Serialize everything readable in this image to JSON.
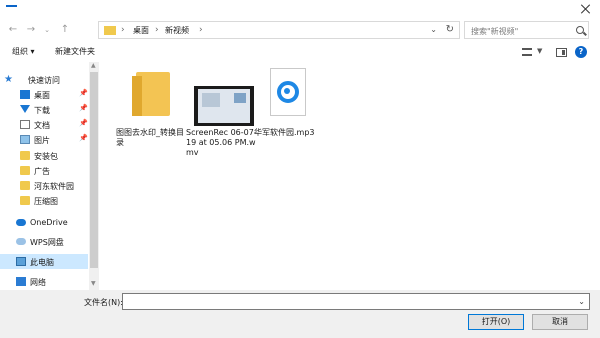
{
  "navbar": {
    "breadcrumbs": [
      "桌面",
      "新视频"
    ],
    "search_placeholder": "搜索\"新视频\""
  },
  "toolbar": {
    "organize": "组织 ▾",
    "new_folder": "新建文件夹"
  },
  "sidebar": {
    "items": [
      {
        "label": "快速访问",
        "icon": "star-icon"
      },
      {
        "label": "桌面",
        "icon": "desktop-icon",
        "pinned": true
      },
      {
        "label": "下载",
        "icon": "download-icon",
        "pinned": true
      },
      {
        "label": "文档",
        "icon": "document-icon",
        "pinned": true
      },
      {
        "label": "图片",
        "icon": "picture-icon",
        "pinned": true
      },
      {
        "label": "安装包",
        "icon": "folder-icon"
      },
      {
        "label": "广告",
        "icon": "folder-icon"
      },
      {
        "label": "河东软件园",
        "icon": "folder-icon"
      },
      {
        "label": "压缩图",
        "icon": "folder-icon"
      },
      {
        "label": "OneDrive",
        "icon": "cloud-icon"
      },
      {
        "label": "WPS网盘",
        "icon": "cloud-icon"
      },
      {
        "label": "此电脑",
        "icon": "computer-icon",
        "selected": true
      },
      {
        "label": "网络",
        "icon": "network-icon"
      }
    ]
  },
  "files": [
    {
      "name": "图图去水印_转换目录",
      "type": "folder"
    },
    {
      "name": "ScreenRec 06-07-19 at 05.06 PM.wmv",
      "type": "video"
    },
    {
      "name": "华军软件园.mp3",
      "type": "audio"
    }
  ],
  "footer": {
    "filename_label": "文件名(N):",
    "filename_value": "",
    "open_button": "打开(O)",
    "cancel_button": "取消"
  },
  "colors": {
    "accent": "#0078d7",
    "selected_bg": "#cce8ff",
    "folder": "#f3c453"
  }
}
